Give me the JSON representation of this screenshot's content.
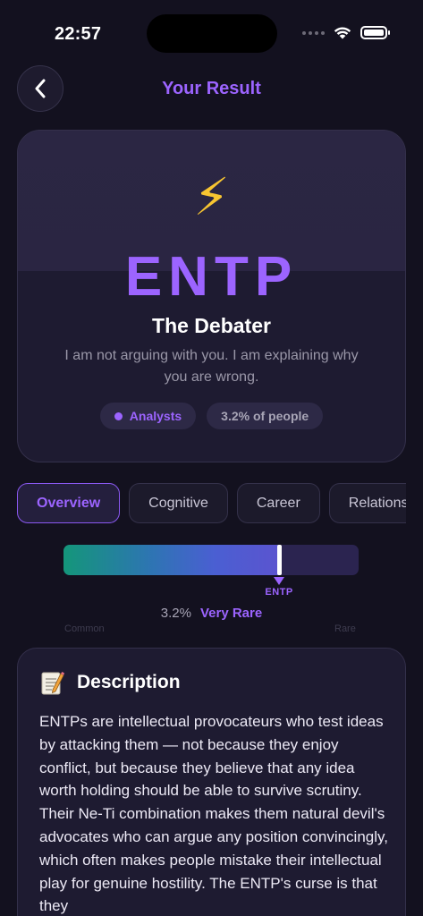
{
  "status_bar": {
    "time": "22:57"
  },
  "header": {
    "title": "Your Result"
  },
  "result": {
    "emoji": "⚡",
    "type": "ENTP",
    "name": "The Debater",
    "quote": "I am not arguing with you. I am explaining why you are wrong.",
    "group": "Analysts",
    "population": "3.2% of people"
  },
  "tabs": [
    {
      "label": "Overview",
      "active": true
    },
    {
      "label": "Cognitive",
      "active": false
    },
    {
      "label": "Career",
      "active": false
    },
    {
      "label": "Relationships",
      "active": false
    }
  ],
  "rarity": {
    "marker_label": "ENTP",
    "percent": "3.2%",
    "rank": "Very Rare",
    "scale_min_label": "Common",
    "scale_max_label": "Rare",
    "position_fraction": 0.73
  },
  "description": {
    "title": "Description",
    "text": "ENTPs are intellectual provocateurs who test ideas by attacking them — not because they enjoy conflict, but because they believe that any idea worth holding should be able to survive scrutiny. Their Ne-Ti combination makes them natural devil's advocates who can argue any position convincingly, which often makes people mistake their intellectual play for genuine hostility. The ENTP's curse is that they"
  },
  "colors": {
    "background": "#13111f",
    "accent": "#9c64ff",
    "card": "#1e1b31"
  }
}
